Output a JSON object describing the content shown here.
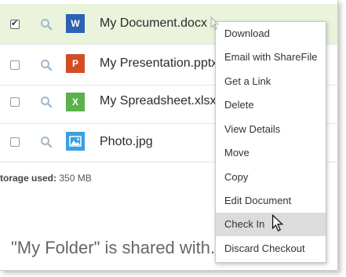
{
  "files": [
    {
      "name": "My Document.docx",
      "icon_letter": "W",
      "icon_name": "word-icon",
      "icon_color": "#2c62b6",
      "checked": true
    },
    {
      "name": "My Presentation.pptx",
      "icon_letter": "P",
      "icon_name": "powerpoint-icon",
      "icon_color": "#d24d26",
      "checked": false
    },
    {
      "name": "My Spreadsheet.xlsx",
      "icon_letter": "X",
      "icon_name": "excel-icon",
      "icon_color": "#5bb24a",
      "checked": false
    },
    {
      "name": "Photo.jpg",
      "icon_letter": "",
      "icon_name": "image-icon",
      "icon_color": "#3aa0e0",
      "checked": false
    }
  ],
  "storage": {
    "label": "torage used:",
    "value": "350 MB"
  },
  "shared_text": "\"My Folder\" is shared with...",
  "context_menu": {
    "items": [
      "Download",
      "Email with ShareFile",
      "Get a Link",
      "Delete",
      "View Details",
      "Move",
      "Copy",
      "Edit Document",
      "Check In",
      "Discard Checkout"
    ],
    "hovered": "Check In"
  },
  "colors": {
    "selected_row": "#eaf3dc",
    "menu_hover": "#dcdcdc"
  }
}
